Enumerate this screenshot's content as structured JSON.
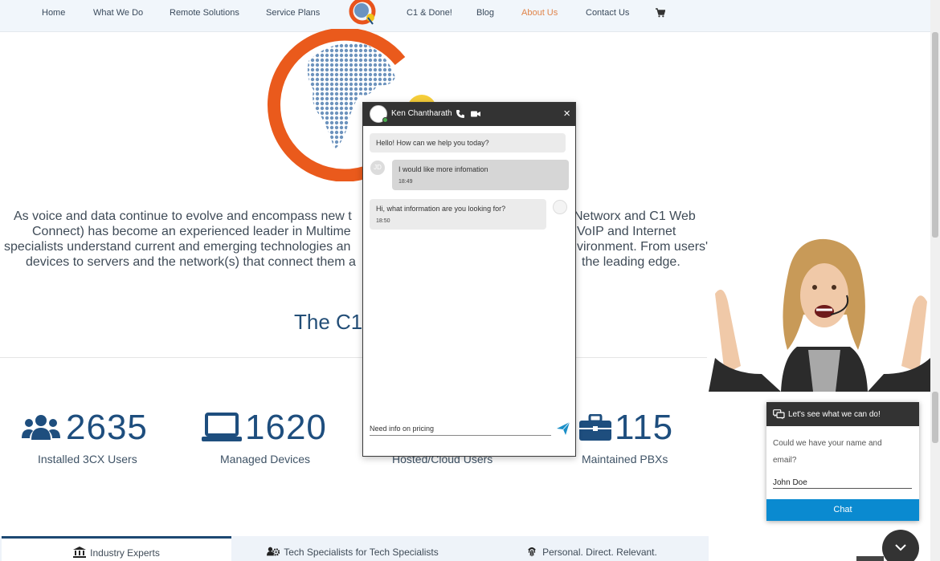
{
  "nav": {
    "items": [
      {
        "label": "Home"
      },
      {
        "label": "What We Do"
      },
      {
        "label": "Remote Solutions"
      },
      {
        "label": "Service Plans"
      },
      {
        "label": "C1 & Done!"
      },
      {
        "label": "Blog"
      },
      {
        "label": "About Us",
        "active": true
      },
      {
        "label": "Contact Us"
      }
    ],
    "cart_icon": "cart-icon",
    "logo_icon": "globe-logo"
  },
  "intro": {
    "lines": [
      {
        "left": "As voice and data continue to evolve and encompass new t",
        "right": "Networx and C1 Web"
      },
      {
        "left": "Connect) has become an experienced leader in Multime",
        "right": "VoIP and Internet"
      },
      {
        "left": "specialists understand current and emerging technologies an",
        "right": "vironment. From users'"
      },
      {
        "left": "devices to servers and the network(s) that connect them a",
        "right": "the leading edge."
      }
    ]
  },
  "section_title": "The C1",
  "stats": [
    {
      "number": "2635",
      "label": "Installed 3CX Users",
      "icon": "users-icon"
    },
    {
      "number": "1620",
      "label": "Managed Devices",
      "icon": "laptop-icon"
    },
    {
      "number": "",
      "label": "Hosted/Cloud Users",
      "icon": ""
    },
    {
      "number": "115",
      "label": "Maintained PBXs",
      "icon": "briefcase-icon"
    }
  ],
  "tabs": [
    {
      "label": "Industry Experts",
      "icon": "bank-icon",
      "active": true
    },
    {
      "label": "Tech Specialists for Tech Specialists",
      "icon": "team-gear-icon"
    },
    {
      "label": "Personal. Direct. Relevant.",
      "icon": "fingerprint-icon"
    }
  ],
  "chat": {
    "agent_name": "Ken Chantharath",
    "user_initials": "JD",
    "messages": [
      {
        "from": "agent",
        "text": "Hello! How can we help you today?",
        "time": ""
      },
      {
        "from": "user",
        "text": "I would like more infomation",
        "time": "18:49"
      },
      {
        "from": "agent",
        "text": "Hi, what information are you looking for?",
        "time": "18:50"
      }
    ],
    "input_value": "Need info on pricing",
    "icons": {
      "phone": "phone-icon",
      "video": "video-icon",
      "close": "close-icon",
      "send": "send-icon"
    },
    "close_glyph": "×"
  },
  "widget": {
    "title": "Let's see what we can do!",
    "question_line1": "Could we have your name and",
    "question_line2": "email?",
    "input_value": "John Doe",
    "button_label": "Chat"
  },
  "colors": {
    "nav_bg": "#f1f6fb",
    "accent_orange": "#e0844a",
    "brand_blue": "#1e4e7e",
    "chat_header": "#333333",
    "chat_button": "#0a8ad0"
  }
}
